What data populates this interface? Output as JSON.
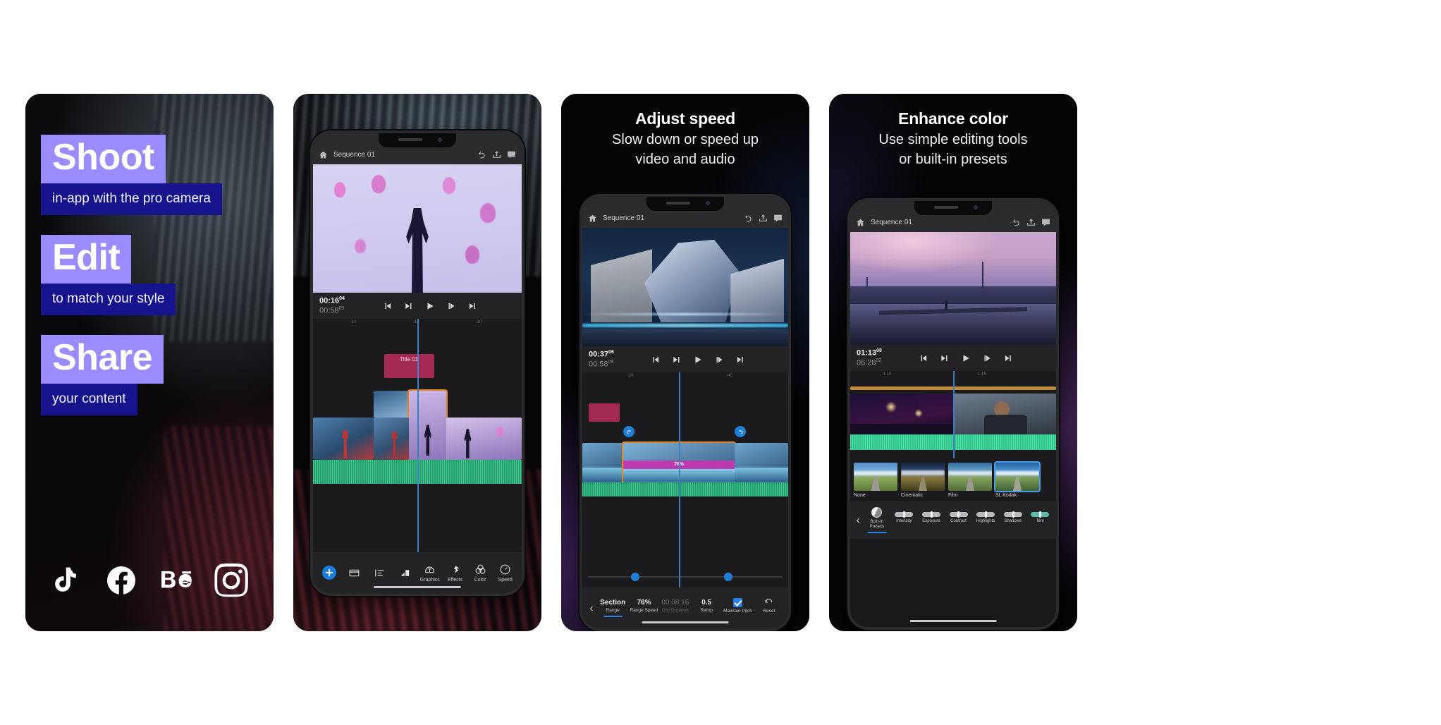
{
  "panel1": {
    "promos": [
      {
        "head": "Shoot",
        "sub": "in-app with the pro camera"
      },
      {
        "head": "Edit",
        "sub": "to match your style"
      },
      {
        "head": "Share",
        "sub": "your content"
      }
    ],
    "socials": [
      {
        "name": "tiktok-icon",
        "label": "TikTok"
      },
      {
        "name": "facebook-icon",
        "label": "Facebook"
      },
      {
        "name": "behance-icon",
        "label": "Behance"
      },
      {
        "name": "instagram-icon",
        "label": "Instagram"
      }
    ],
    "colors": {
      "head_bg": "#9a8bff",
      "sub_bg": "#16138c",
      "text": "#ffffff"
    }
  },
  "panel2": {
    "appbar": {
      "sequence": "Sequence 01",
      "home": "home-icon",
      "undo": "undo-icon",
      "share": "share-icon",
      "comment": "comment-icon"
    },
    "transport": {
      "current": "00:16",
      "current_frames": "04",
      "duration": "00:58",
      "duration_frames": "09",
      "buttons": [
        "go-to-start",
        "step-back",
        "play",
        "step-forward",
        "go-to-end"
      ]
    },
    "ruler_ticks": [
      ":10",
      ":15",
      ":20"
    ],
    "timeline": {
      "title_clip": "Title 01"
    },
    "toolbar": {
      "add": "+",
      "items": [
        {
          "icon": "clip-icon",
          "label": ""
        },
        {
          "icon": "audio-levels-icon",
          "label": ""
        },
        {
          "icon": "transform-icon",
          "label": ""
        },
        {
          "icon": "graphics-icon",
          "label": "Graphics"
        },
        {
          "icon": "effects-icon",
          "label": "Effects"
        },
        {
          "icon": "color-icon",
          "label": "Color"
        },
        {
          "icon": "speed-icon",
          "label": "Speed"
        }
      ]
    }
  },
  "panel3": {
    "heading": "Adjust speed",
    "subheading_line1": "Slow down or speed up",
    "subheading_line2": "video and audio",
    "appbar": {
      "sequence": "Sequence 01"
    },
    "transport": {
      "current": "00:37",
      "current_frames": "06",
      "duration": "00:58",
      "duration_frames": "09"
    },
    "ruler_ticks": [
      ":20",
      ":40"
    ],
    "clip_badge": "76%",
    "speedbar": {
      "back": "‹",
      "items": [
        {
          "value": "Section",
          "label": "Range",
          "active": true,
          "dim": false
        },
        {
          "value": "76%",
          "label": "Range Speed",
          "active": false,
          "dim": false
        },
        {
          "value": "00:08:16",
          "label": "Clip Duration",
          "active": false,
          "dim": true
        },
        {
          "value": "0.5",
          "label": "Ramp",
          "active": false,
          "dim": false
        },
        {
          "value": "checkbox",
          "label": "Maintain Pitch",
          "active": false,
          "dim": false
        },
        {
          "value": "reset-icon",
          "label": "Reset",
          "active": false,
          "dim": false
        }
      ]
    }
  },
  "panel4": {
    "heading": "Enhance color",
    "subheading_line1": "Use simple editing tools",
    "subheading_line2": "or built-in presets",
    "appbar": {
      "sequence": "Sequence 01"
    },
    "transport": {
      "current": "01:13",
      "current_frames": "08",
      "duration": "06:28",
      "duration_frames": "02"
    },
    "ruler_ticks": [
      "1:10",
      "1:15"
    ],
    "presets": [
      {
        "label": "None",
        "selected": false
      },
      {
        "label": "Cinematic",
        "selected": false
      },
      {
        "label": "Film",
        "selected": false
      },
      {
        "label": "SL Kodak",
        "selected": true
      }
    ],
    "colorbar": {
      "back": "‹",
      "items": [
        {
          "label": "Built-In Presets",
          "control": "presets-icon",
          "active": true
        },
        {
          "label": "Intensity",
          "control": "slider",
          "active": false
        },
        {
          "label": "Exposure",
          "control": "slider",
          "active": false
        },
        {
          "label": "Contrast",
          "control": "slider",
          "active": false
        },
        {
          "label": "Highlights",
          "control": "slider",
          "active": false
        },
        {
          "label": "Shadows",
          "control": "slider",
          "active": false
        },
        {
          "label": "Tem",
          "control": "slider-teal",
          "active": false
        }
      ]
    }
  }
}
